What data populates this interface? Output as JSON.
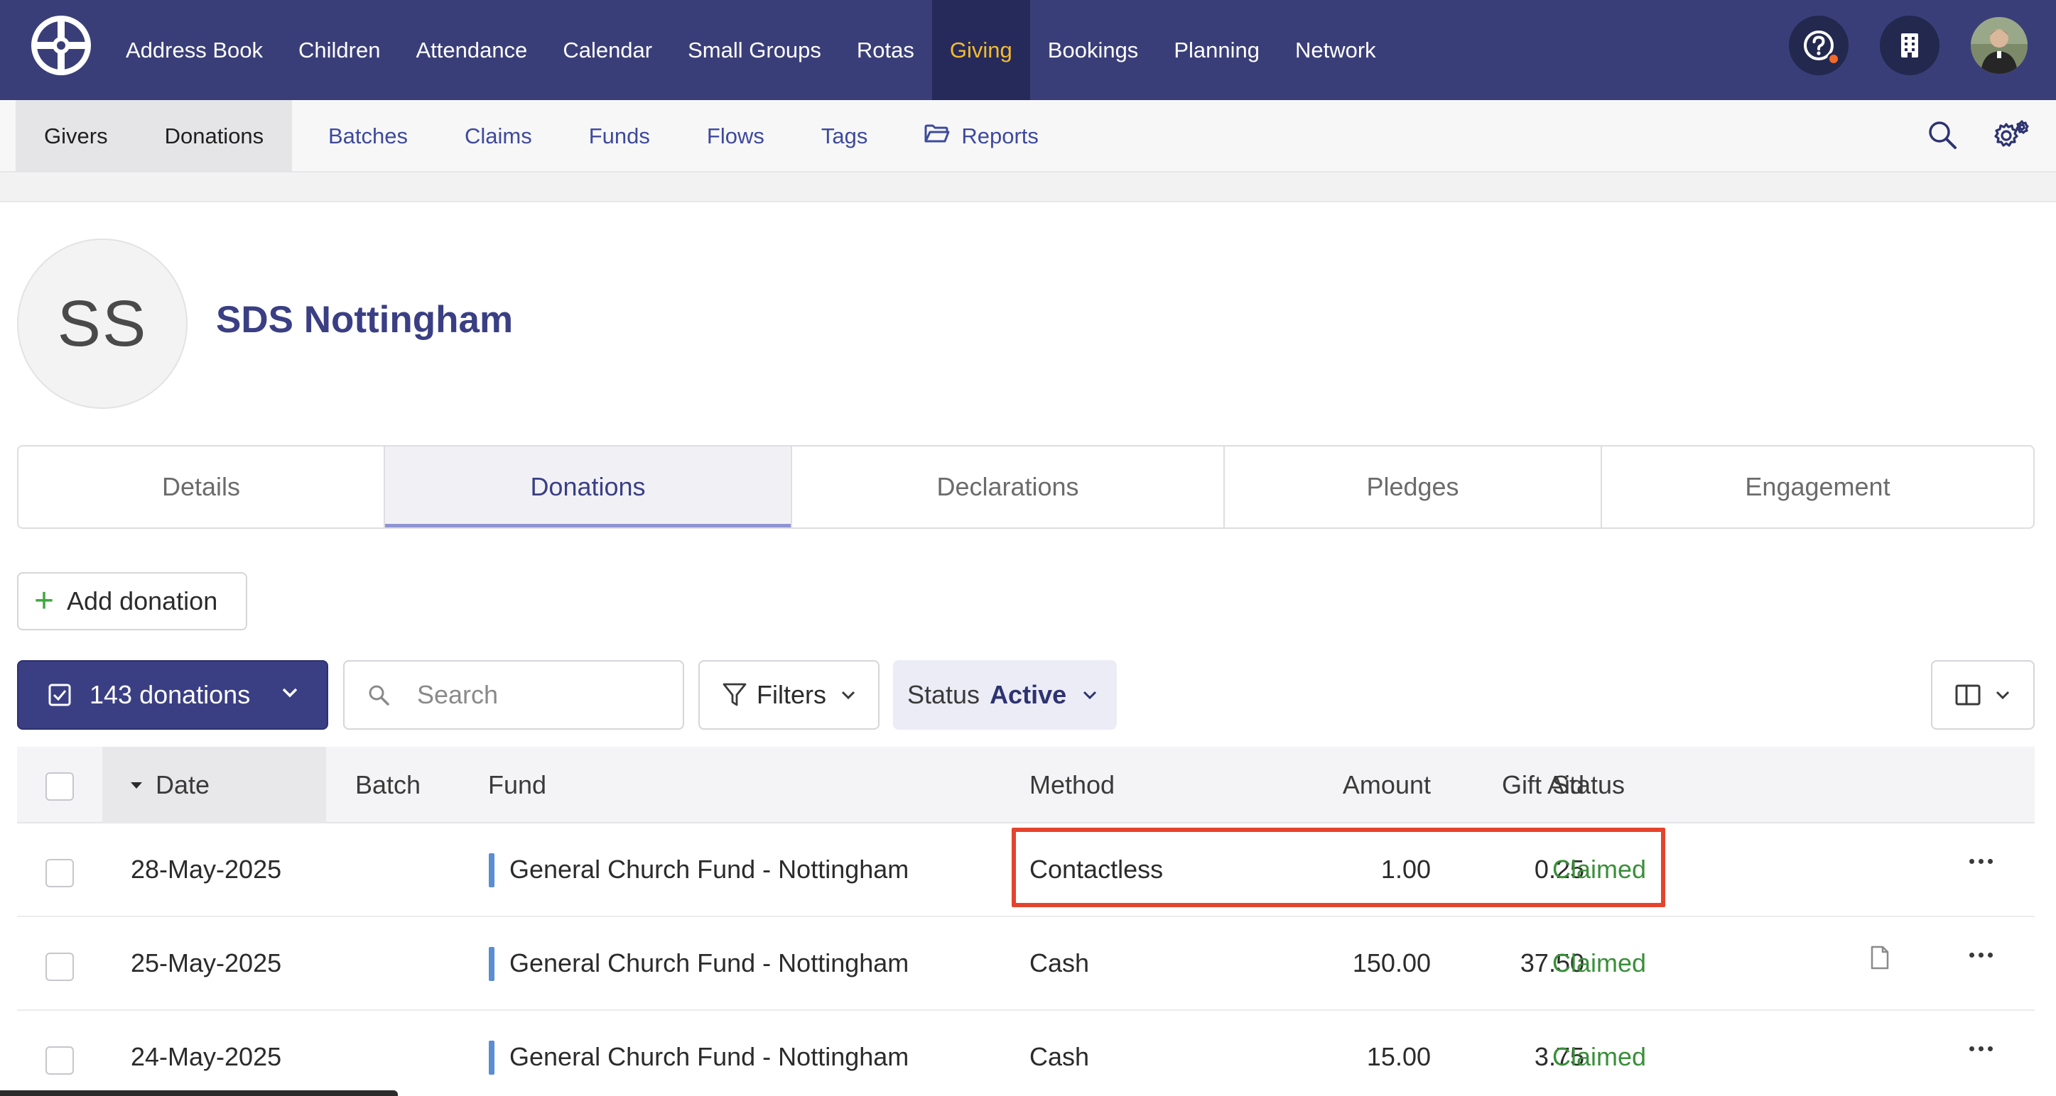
{
  "topnav": {
    "items": [
      "Address Book",
      "Children",
      "Attendance",
      "Calendar",
      "Small Groups",
      "Rotas",
      "Giving",
      "Bookings",
      "Planning",
      "Network"
    ],
    "active": "Giving"
  },
  "subnav": {
    "group": [
      "Givers",
      "Donations"
    ],
    "links": [
      "Batches",
      "Claims",
      "Funds",
      "Flows",
      "Tags",
      "Reports"
    ]
  },
  "profile": {
    "initials": "SS",
    "name": "SDS Nottingham"
  },
  "tabs": [
    {
      "label": "Details"
    },
    {
      "label": "Donations"
    },
    {
      "label": "Declarations"
    },
    {
      "label": "Pledges"
    },
    {
      "label": "Engagement"
    }
  ],
  "toolbar": {
    "add_label": "Add donation",
    "count_label": "143 donations",
    "search_placeholder": "Search",
    "filters_label": "Filters",
    "status_label": "Status",
    "status_value": "Active"
  },
  "table": {
    "headers": {
      "date": "Date",
      "batch": "Batch",
      "fund": "Fund",
      "method": "Method",
      "amount": "Amount",
      "gift_aid": "Gift Aid",
      "status": "Status"
    },
    "rows": [
      {
        "date": "28-May-2025",
        "batch": "",
        "fund": "General Church Fund - Nottingham",
        "method": "Contactless",
        "amount": "1.00",
        "gift_aid": "0.25",
        "status": "Claimed"
      },
      {
        "date": "25-May-2025",
        "batch": "",
        "fund": "General Church Fund - Nottingham",
        "method": "Cash",
        "amount": "150.00",
        "gift_aid": "37.50",
        "status": "Claimed"
      },
      {
        "date": "24-May-2025",
        "batch": "",
        "fund": "General Church Fund - Nottingham",
        "method": "Cash",
        "amount": "15.00",
        "gift_aid": "3.75",
        "status": "Claimed"
      }
    ]
  },
  "colors": {
    "nav_bg": "#3a3e78",
    "accent": "#f5bb2c",
    "brand": "#3a3f84",
    "claimed": "#3a8f3a",
    "highlight": "#e5432d"
  },
  "icons": [
    "logo-icon",
    "help-icon",
    "building-icon",
    "search-icon",
    "settings-icon",
    "folder-icon",
    "plus-icon",
    "checkbox-icon",
    "chevron-down-icon",
    "filter-icon",
    "columns-icon",
    "sort-down-icon",
    "document-icon",
    "more-icon"
  ]
}
